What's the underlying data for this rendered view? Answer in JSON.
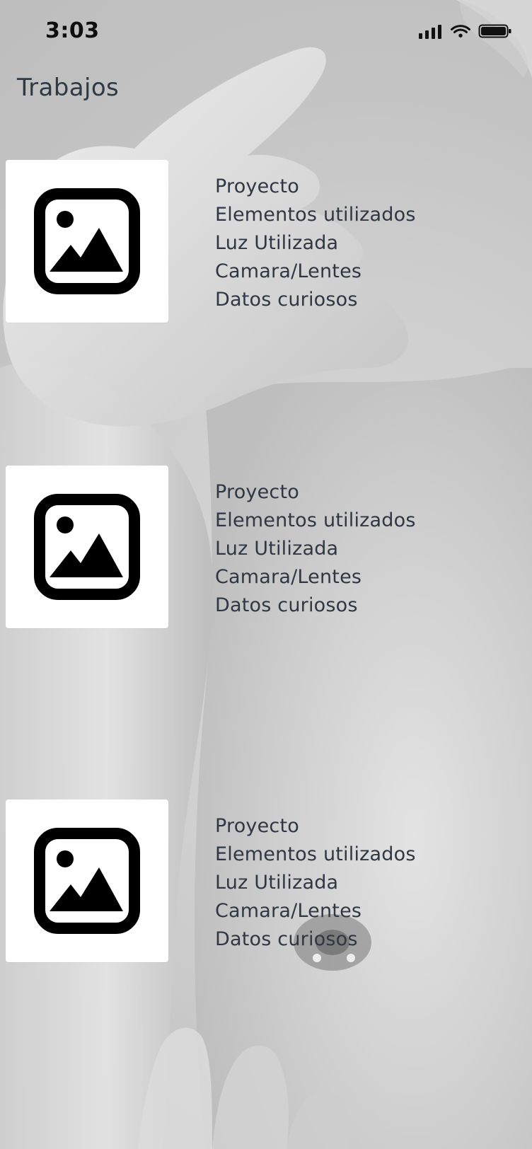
{
  "status_bar": {
    "time": "3:03",
    "icons": [
      "cellular-signal-icon",
      "wifi-icon",
      "battery-icon"
    ]
  },
  "header": {
    "title": "Trabajos"
  },
  "works": [
    {
      "thumbnail_icon": "image-placeholder-icon",
      "lines": [
        "Proyecto",
        "Elementos utilizados",
        "Luz Utilizada",
        "Camara/Lentes",
        "Datos curiosos"
      ]
    },
    {
      "thumbnail_icon": "image-placeholder-icon",
      "lines": [
        "Proyecto",
        "Elementos utilizados",
        "Luz Utilizada",
        "Camara/Lentes",
        "Datos curiosos"
      ]
    },
    {
      "thumbnail_icon": "image-placeholder-icon",
      "lines": [
        "Proyecto",
        "Elementos utilizados",
        "Luz Utilizada",
        "Camara/Lentes",
        "Datos curiosos"
      ]
    }
  ],
  "colors": {
    "text": "#2e3743",
    "thumb_bg": "#ffffff",
    "icon": "#000000"
  }
}
